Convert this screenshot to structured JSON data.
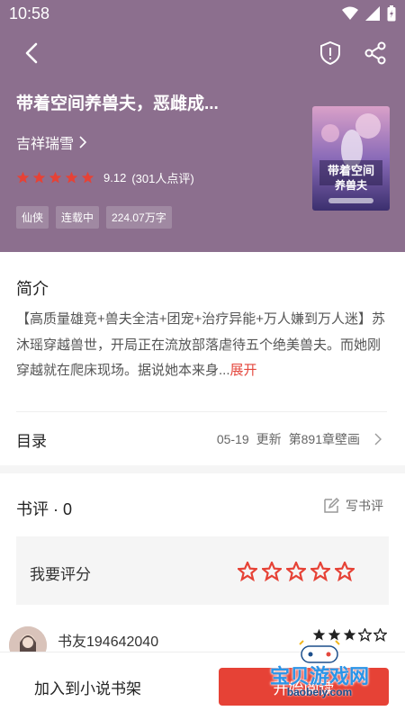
{
  "status_bar": {
    "time": "10:58"
  },
  "book": {
    "title": "带着空间养兽夫，恶雌成...",
    "author": "吉祥瑞雪",
    "rating": "9.12",
    "rating_count": "(301人点评)",
    "stars_filled": 5,
    "tags": [
      "仙侠",
      "连载中",
      "224.07万字"
    ],
    "cover_title": "带着空间养兽夫"
  },
  "intro": {
    "heading": "简介",
    "body": "【高质量雄竞+兽夫全洁+团宠+治疗异能+万人嫌到万人迷】苏沐瑶穿越兽世，开局正在流放部落虐待五个绝美兽夫。而她刚穿越就在爬床现场。据说她本来身...",
    "more": "展开"
  },
  "toc": {
    "label": "目录",
    "date": "05-19",
    "update": "更新",
    "chapter": "第891章壁画"
  },
  "reviews": {
    "heading": "书评 · 0",
    "write_label": "写书评",
    "rate_label": "我要评分",
    "items": [
      {
        "user": "书友194642040",
        "stars_filled": 3
      }
    ]
  },
  "bottom": {
    "add_shelf": "加入到小说书架",
    "read_label": "开始阅读"
  },
  "watermark": {
    "text": "宝贝游戏网",
    "url": "baobeiy.com"
  },
  "colors": {
    "header_bg": "#8c6f8e",
    "accent_red": "#e4473d",
    "star_red": "#e64236"
  }
}
